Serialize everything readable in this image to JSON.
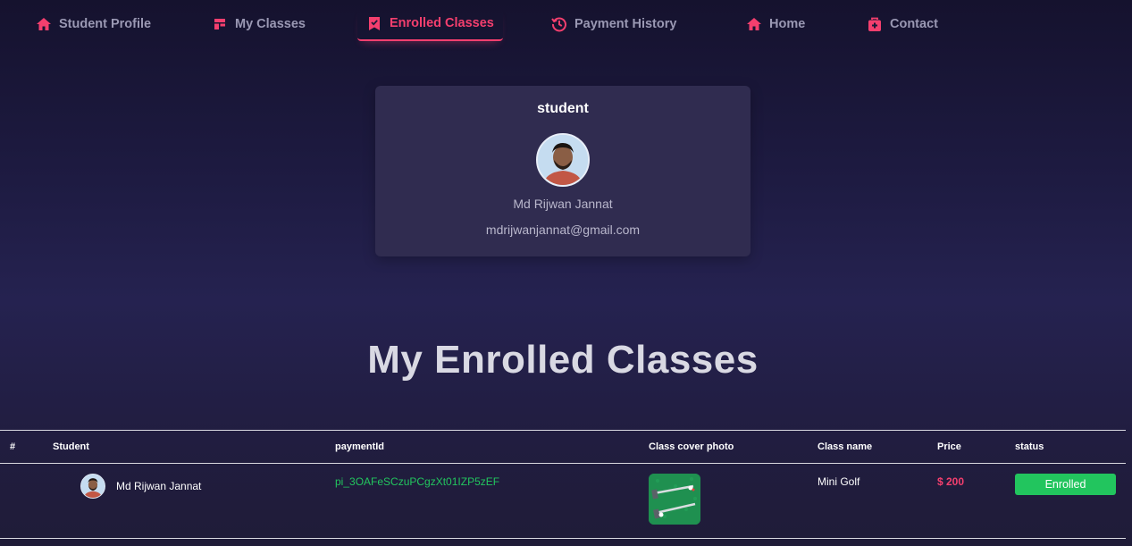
{
  "nav": {
    "items": [
      {
        "label": "Student Profile",
        "icon": "home-icon"
      },
      {
        "label": "My Classes",
        "icon": "layout-icon"
      },
      {
        "label": "Enrolled Classes",
        "icon": "bookmark-check-icon"
      },
      {
        "label": "Payment History",
        "icon": "history-icon"
      },
      {
        "label": "Home",
        "icon": "home-icon"
      },
      {
        "label": "Contact",
        "icon": "briefcase-medical-icon"
      }
    ],
    "active_label": "Enrolled Classes"
  },
  "profile": {
    "role": "student",
    "name": "Md Rijwan Jannat",
    "email": "mdrijwanjannat@gmail.com"
  },
  "page_title": "My Enrolled Classes",
  "table": {
    "headers": [
      "#",
      "Student",
      "paymentId",
      "Class cover photo",
      "Class name",
      "Price",
      "status"
    ],
    "rows": [
      {
        "index": "",
        "student": "Md Rijwan Jannat",
        "payment_id": "pi_3OAFeSCzuPCgzXt01IZP5zEF",
        "class_name": "Mini Golf",
        "price": "$ 200",
        "status": "Enrolled"
      }
    ]
  },
  "colors": {
    "accent": "#f43f6e",
    "nav_text": "#9a98b3",
    "payment_id": "#22c55e",
    "price": "#f43f6e",
    "status_badge": "#22c55e",
    "card_bg": "#302c50"
  }
}
